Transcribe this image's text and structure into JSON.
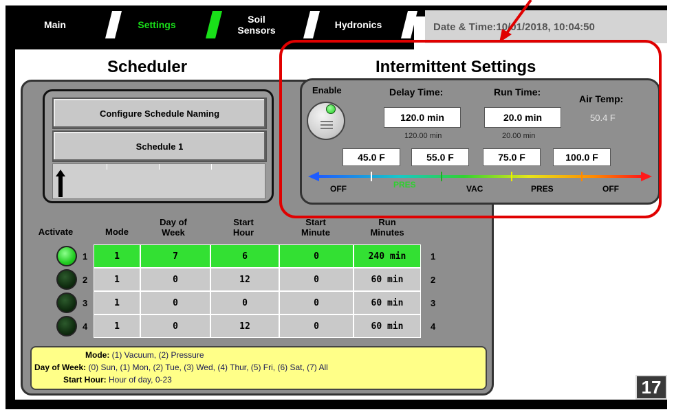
{
  "tabs": [
    {
      "label": "Main"
    },
    {
      "label": "Settings"
    },
    {
      "label": "Soil\nSensors"
    },
    {
      "label": "Hydronics"
    }
  ],
  "datetime": "Date & Time:10/01/2018, 10:04:50",
  "scheduler": {
    "title": "Scheduler",
    "configure_button": "Configure Schedule Naming",
    "schedule_button": "Schedule 1",
    "headers": {
      "activate": "Activate",
      "mode": "Mode",
      "dow": "Day of\nWeek",
      "start_hour": "Start\nHour",
      "start_minute": "Start\nMinute",
      "run_minutes": "Run\nMinutes"
    },
    "rows": [
      {
        "num": "1",
        "active": true,
        "mode": "1",
        "dow": "7",
        "start_hour": "6",
        "start_minute": "0",
        "run": "240 min",
        "right": "1"
      },
      {
        "num": "2",
        "active": false,
        "mode": "1",
        "dow": "0",
        "start_hour": "12",
        "start_minute": "0",
        "run": "60 min",
        "right": "2"
      },
      {
        "num": "3",
        "active": false,
        "mode": "1",
        "dow": "0",
        "start_hour": "0",
        "start_minute": "0",
        "run": "60 min",
        "right": "3"
      },
      {
        "num": "4",
        "active": false,
        "mode": "1",
        "dow": "0",
        "start_hour": "12",
        "start_minute": "0",
        "run": "60 min",
        "right": "4"
      }
    ],
    "legend": {
      "mode_key": "Mode:",
      "mode_val": "(1) Vacuum, (2) Pressure",
      "dow_key": "Day of Week:",
      "dow_val": "(0) Sun, (1) Mon, (2) Tue, (3) Wed, (4) Thur, (5) Fri, (6) Sat, (7) All",
      "hour_key": "Start Hour:",
      "hour_val": "Hour of day, 0-23"
    }
  },
  "intermittent": {
    "title": "Intermittent Settings",
    "enable_label": "Enable",
    "delay_label": "Delay Time:",
    "delay_value": "120.0 min",
    "delay_sub": "120.00 min",
    "run_label": "Run Time:",
    "run_value": "20.0 min",
    "run_sub": "20.00 min",
    "air_label": "Air Temp:",
    "air_value": "50.4 F",
    "thresholds": [
      "45.0 F",
      "55.0 F",
      "75.0 F",
      "100.0 F"
    ],
    "zones": [
      "OFF",
      "PRES",
      "VAC",
      "PRES",
      "OFF"
    ]
  },
  "page_number": "17"
}
